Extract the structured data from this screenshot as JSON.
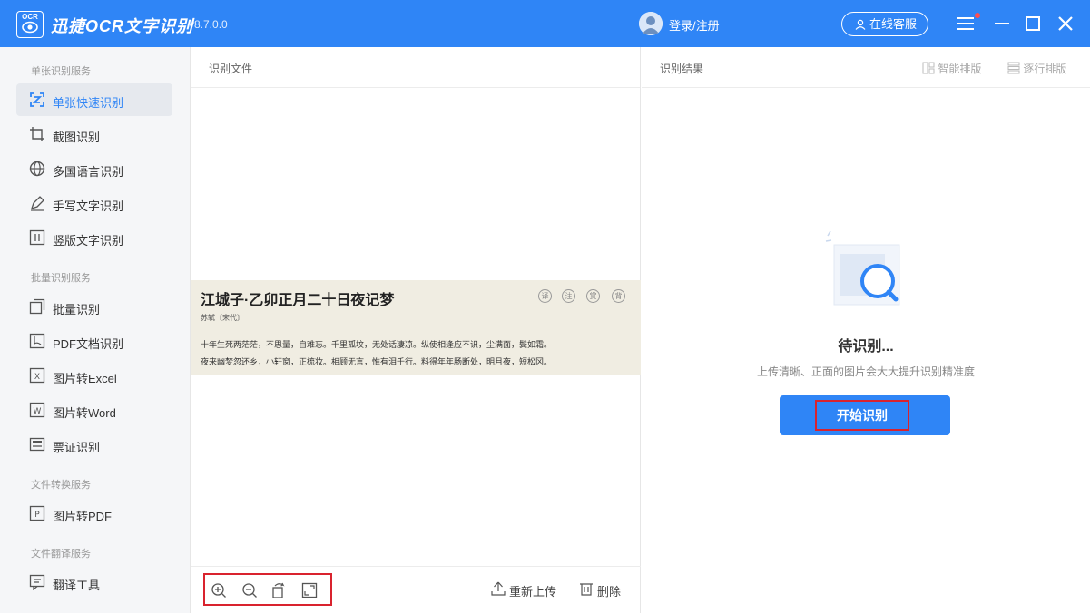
{
  "titlebar": {
    "logo_text": "OCR",
    "app_name": "迅捷OCR文字识别",
    "version": "v8.7.0.0",
    "login": "登录/注册",
    "service": "在线客服",
    "accent": "#2f85f6"
  },
  "sidebar": {
    "sections": [
      {
        "title": "单张识别服务",
        "items": [
          {
            "label": "单张快速识别",
            "icon": "quick-scan-icon",
            "active": true
          },
          {
            "label": "截图识别",
            "icon": "crop-icon"
          },
          {
            "label": "多国语言识别",
            "icon": "globe-icon"
          },
          {
            "label": "手写文字识别",
            "icon": "pen-icon"
          },
          {
            "label": "竖版文字识别",
            "icon": "vertical-text-icon"
          }
        ]
      },
      {
        "title": "批量识别服务",
        "items": [
          {
            "label": "批量识别",
            "icon": "batch-icon"
          },
          {
            "label": "PDF文档识别",
            "icon": "pdf-icon"
          },
          {
            "label": "图片转Excel",
            "icon": "excel-icon"
          },
          {
            "label": "图片转Word",
            "icon": "word-icon"
          },
          {
            "label": "票证识别",
            "icon": "id-card-icon"
          }
        ]
      },
      {
        "title": "文件转换服务",
        "items": [
          {
            "label": "图片转PDF",
            "icon": "pdf-convert-icon"
          }
        ]
      },
      {
        "title": "文件翻译服务",
        "items": [
          {
            "label": "翻译工具",
            "icon": "translate-icon"
          }
        ]
      }
    ]
  },
  "middle": {
    "header": "识别文件",
    "document": {
      "title": "江城子·乙卯正月二十日夜记梦",
      "author": "苏轼〔宋代〕",
      "stamps": [
        "译",
        "注",
        "赏",
        "背"
      ],
      "lines": [
        "十年生死两茫茫，不思量，自难忘。千里孤坟，无处话凄凉。纵使相逢应不识，尘满面，鬓如霜。",
        "夜来幽梦忽还乡，小轩窗，正梳妆。相顾无言，惟有泪千行。料得年年肠断处，明月夜，短松冈。"
      ]
    },
    "footer": {
      "reupload": "重新上传",
      "delete": "删除"
    }
  },
  "right": {
    "header": "识别结果",
    "smart_layout": "智能排版",
    "line_layout": "逐行排版",
    "pending_title": "待识别...",
    "pending_desc": "上传清晰、正面的图片会大大提升识别精准度",
    "start_button": "开始识别"
  }
}
